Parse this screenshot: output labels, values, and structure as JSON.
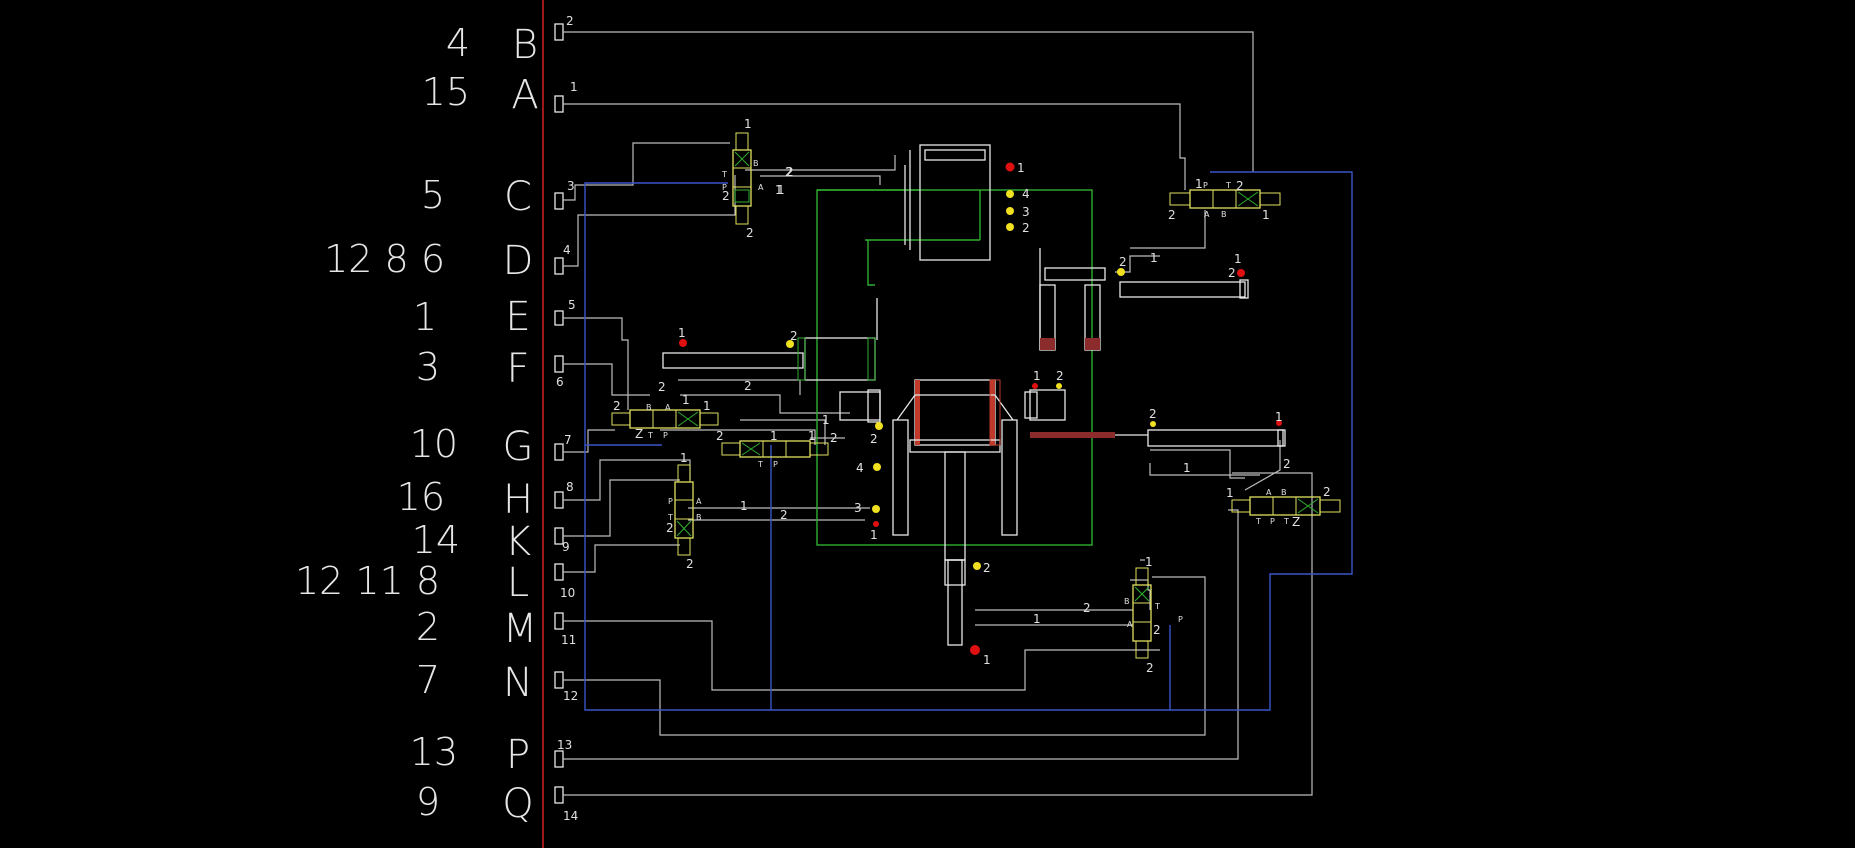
{
  "rows": [
    {
      "id": "B",
      "nums": "4",
      "term": "2"
    },
    {
      "id": "A",
      "nums": "15",
      "term": "1"
    },
    {
      "id": "C",
      "nums": "5",
      "term": "3"
    },
    {
      "id": "D",
      "nums": "12 8 6",
      "term": "4"
    },
    {
      "id": "E",
      "nums": "1",
      "term": "5"
    },
    {
      "id": "F",
      "nums": "3",
      "term": "6"
    },
    {
      "id": "G",
      "nums": "10",
      "term": "7"
    },
    {
      "id": "H",
      "nums": "16",
      "term": "8"
    },
    {
      "id": "K",
      "nums": "14",
      "term": "9"
    },
    {
      "id": "L",
      "nums": "12 11 8",
      "term": "10"
    },
    {
      "id": "M",
      "nums": "2",
      "term": "11"
    },
    {
      "id": "N",
      "nums": "7",
      "term": "12"
    },
    {
      "id": "P",
      "nums": "13",
      "term": "13"
    },
    {
      "id": "Q",
      "nums": "9",
      "term": "14"
    }
  ],
  "valves": [
    {
      "name": "valve-top-left",
      "labels": [
        "1",
        "B",
        "T",
        "P",
        "2",
        "A",
        "2",
        "2",
        "1"
      ]
    },
    {
      "name": "valve-top-right",
      "labels": [
        "1",
        "P",
        "T",
        "2",
        "2",
        "A",
        "B",
        "1"
      ]
    },
    {
      "name": "valve-mid-left",
      "labels": [
        "2",
        "B",
        "A",
        "Z",
        "T",
        "P",
        "1"
      ]
    },
    {
      "name": "valve-mid-center",
      "labels": [
        "2",
        "1",
        "T",
        "P",
        "1"
      ]
    },
    {
      "name": "valve-lower-left",
      "labels": [
        "1",
        "P",
        "A",
        "T",
        "B",
        "2",
        "2"
      ]
    },
    {
      "name": "valve-right",
      "labels": [
        "1",
        "A",
        "B",
        "T",
        "P",
        "T",
        "Z",
        "2"
      ]
    },
    {
      "name": "valve-bottom",
      "labels": [
        "1",
        "B",
        "T",
        "A",
        "2",
        "P",
        "2"
      ]
    }
  ],
  "markers": [
    "1",
    "4",
    "3",
    "2",
    "2",
    "1",
    "2",
    "1",
    "2",
    "1",
    "2",
    "2",
    "1",
    "2",
    "4",
    "3",
    "1",
    "2",
    "1"
  ],
  "wire_labels": [
    "2",
    "1",
    "1",
    "2",
    "1",
    "2",
    "2",
    "1",
    "2",
    "1",
    "2",
    "1",
    "2",
    "1"
  ],
  "colors": {
    "background": "#000000",
    "rail": "#d42020",
    "wire": "#bdbdbd",
    "pneumatic": "#3a55c8",
    "frame": "#2fae2f",
    "valve": "#e0e060",
    "marker_red": "#e01010",
    "marker_yellow": "#f0e020"
  }
}
